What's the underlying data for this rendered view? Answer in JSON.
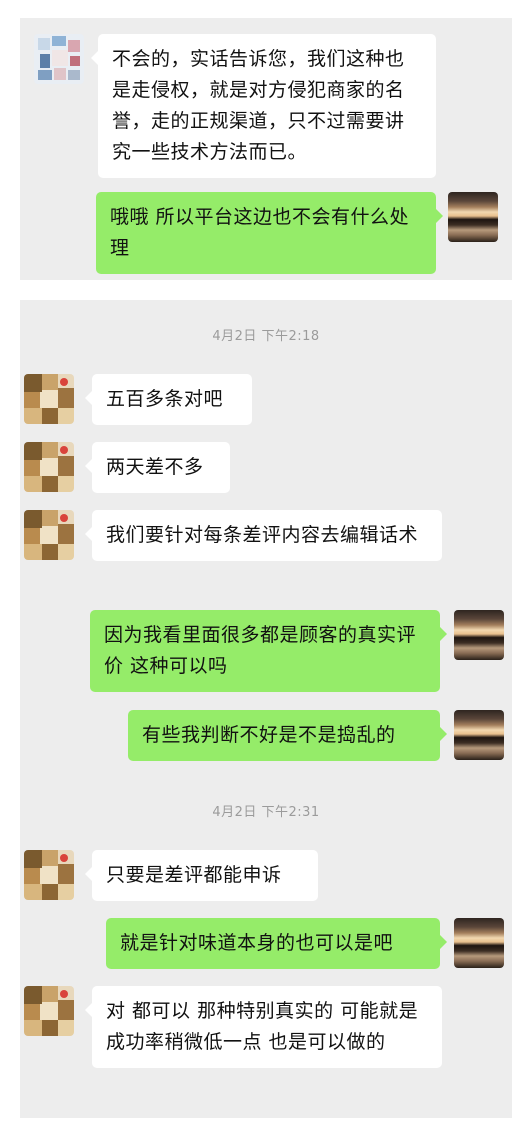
{
  "panel1": {
    "messages": [
      {
        "side": "in",
        "text": "不会的，实话告诉您，我们这种也是走侵权，就是对方侵犯商家的名誉，走的正规渠道，只不过需要讲究一些技术方法而已。",
        "avatar": "pixelated-avatar"
      },
      {
        "side": "out",
        "text": "哦哦 所以平台这边也不会有什么处理",
        "avatar": "sunset-avatar"
      }
    ]
  },
  "panel2": {
    "timestamps": [
      "4月2日 下午2:18",
      "4月2日 下午2:31"
    ],
    "messages": [
      {
        "side": "in",
        "text": "五百多条对吧",
        "avatar": "dog-avatar"
      },
      {
        "side": "in",
        "text": "两天差不多",
        "avatar": "dog-avatar"
      },
      {
        "side": "in",
        "text": "我们要针对每条差评内容去编辑话术",
        "avatar": "dog-avatar"
      },
      {
        "side": "out",
        "text": "因为我看里面很多都是顾客的真实评价 这种可以吗",
        "avatar": "sunset-avatar"
      },
      {
        "side": "out",
        "text": "有些我判断不好是不是捣乱的",
        "avatar": "sunset-avatar"
      },
      {
        "side": "in",
        "text": "只要是差评都能申诉",
        "avatar": "dog-avatar"
      },
      {
        "side": "out",
        "text": "就是针对味道本身的也可以是吧",
        "avatar": "sunset-avatar"
      },
      {
        "side": "in",
        "text": "对  都可以  那种特别真实的 可能就是成功率稍微低一点  也是可以做的",
        "avatar": "dog-avatar"
      }
    ]
  },
  "colors": {
    "panel_bg": "#ededed",
    "incoming_bubble": "#ffffff",
    "outgoing_bubble": "#95ec69",
    "timestamp_text": "#9b9b9b"
  }
}
